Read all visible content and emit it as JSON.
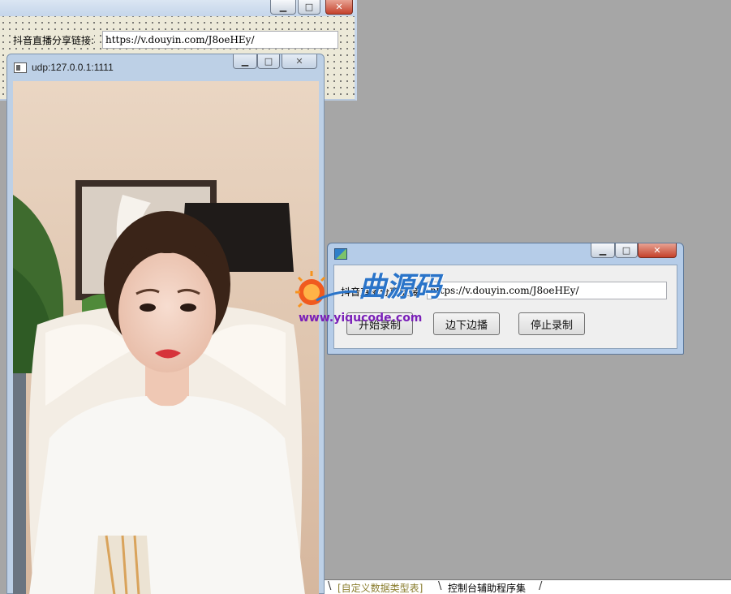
{
  "designer": {
    "label": "抖音直播分享链接:",
    "url": "https://v.douyin.com/J8oeHEy/"
  },
  "video_window": {
    "title": "udp:127.0.0.1:1111"
  },
  "recorder": {
    "label": "抖音直播分享链接:",
    "url": "https://v.douyin.com/J8oeHEy/",
    "buttons": {
      "start": "开始录制",
      "live": "边下边播",
      "stop": "停止录制"
    }
  },
  "watermark": {
    "brand": "曲源码",
    "url": "www.yiqucode.com"
  },
  "tabs": [
    {
      "label": "[自定义数据类型表]"
    },
    {
      "label": "控制台辅助程序集"
    }
  ],
  "window_controls": {
    "minimize": "▁",
    "maximize": "□",
    "close": "✕"
  },
  "colors": {
    "desktop": "#a6a6a6",
    "aero_frame": "#b5cce8",
    "brand_blue": "#2a74c9",
    "watermark_purple": "#7a1fb8",
    "close_red": "#c4412b"
  }
}
